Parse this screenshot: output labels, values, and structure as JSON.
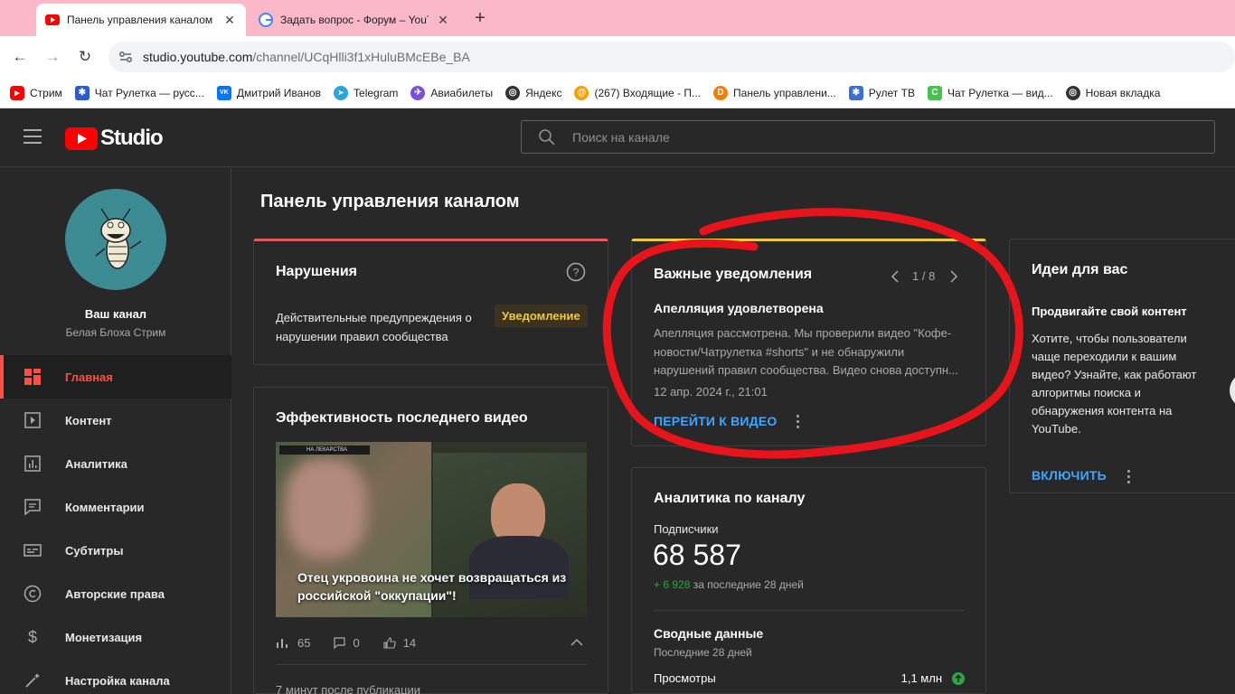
{
  "browser": {
    "tabs": [
      {
        "title": "Панель управления каналом -"
      },
      {
        "title": "Задать вопрос - Форум – YouT"
      }
    ],
    "address": {
      "domain": "studio.youtube.com",
      "path": "/channel/UCqHlli3f1xHuluBMcEBe_BA"
    },
    "bookmarks": [
      {
        "label": "Стрим",
        "icon": "youtube-icon",
        "color": "#ff0000"
      },
      {
        "label": "Чат Рулетка — русс...",
        "icon": "roulette-icon",
        "color": "#2a5bd7"
      },
      {
        "label": "Дмитрий Иванов",
        "icon": "vk-icon",
        "color": "#0077ff"
      },
      {
        "label": "Telegram",
        "icon": "telegram-icon",
        "color": "#2aa3df"
      },
      {
        "label": "Авиабилеты",
        "icon": "plane-icon",
        "color": "#7b4fd8"
      },
      {
        "label": "Яндекс",
        "icon": "globe-icon",
        "color": "#333333"
      },
      {
        "label": "(267) Входящие - П...",
        "icon": "mail-icon",
        "color": "#f2a100"
      },
      {
        "label": "Панель управлени...",
        "icon": "donation-icon",
        "color": "#f57d00"
      },
      {
        "label": "Рулет ТВ",
        "icon": "gear-icon",
        "color": "#3b6fd0"
      },
      {
        "label": "Чат Рулетка — вид...",
        "icon": "chat-icon",
        "color": "#46c34c"
      },
      {
        "label": "Новая вкладка",
        "icon": "globe-icon",
        "color": "#333333"
      }
    ]
  },
  "header": {
    "logo": "Studio",
    "search_placeholder": "Поиск на канале"
  },
  "sidebar": {
    "channel_name": "Ваш канал",
    "channel_handle": "Белая Блоха Стрим",
    "items": [
      {
        "label": "Главная",
        "icon": "dashboard-icon"
      },
      {
        "label": "Контент",
        "icon": "content-icon"
      },
      {
        "label": "Аналитика",
        "icon": "analytics-icon"
      },
      {
        "label": "Комментарии",
        "icon": "comments-icon"
      },
      {
        "label": "Субтитры",
        "icon": "subtitles-icon"
      },
      {
        "label": "Авторские права",
        "icon": "copyright-icon"
      },
      {
        "label": "Монетизация",
        "icon": "dollar-icon"
      },
      {
        "label": "Настройка канала",
        "icon": "wand-icon"
      }
    ]
  },
  "main": {
    "title": "Панель управления каналом",
    "violations": {
      "title": "Нарушения",
      "text": "Действительные предупреждения о нарушении правил сообщества",
      "badge": "Уведомление"
    },
    "performance": {
      "title": "Эффективность последнего видео",
      "video_caption": "Отец укровоина не хочет возвращаться из российской \"оккупации\"!",
      "video_overlay_tag": "НА ЛЕКАРСТВА",
      "views": "65",
      "comments": "0",
      "likes": "14",
      "footer": "7 минут после публикации"
    },
    "notifications": {
      "title": "Важные уведомления",
      "pager": "1 / 8",
      "subtitle": "Апелляция удовлетворена",
      "body": "Апелляция рассмотрена. Мы проверили видео \"Кофе-новости/Чатрулетка #shorts\" и не обнаружили нарушений правил сообщества. Видео снова доступн...",
      "date": "12 апр. 2024 г., 21:01",
      "action": "ПЕРЕЙТИ К ВИДЕО"
    },
    "analytics": {
      "title": "Аналитика по каналу",
      "subs_label": "Подписчики",
      "subs_value": "68 587",
      "subs_delta": "+ 6 928",
      "subs_period": "за последние 28 дней",
      "summary_title": "Сводные данные",
      "summary_period": "Последние 28 дней",
      "views_label": "Просмотры",
      "views_value": "1,1 млн"
    },
    "ideas": {
      "title": "Идеи для вас",
      "subtitle": "Продвигайте свой контент",
      "body": "Хотите, чтобы пользователи чаще переходили к вашим видео? Узнайте, как работают алгоритмы поиска и обнаружения контента на YouTube.",
      "action": "ВКЛЮЧИТЬ"
    }
  },
  "colors": {
    "accent": "#ff4e45",
    "link": "#3ea6ff",
    "warning": "#f0c93b",
    "positive": "#2ba640",
    "annotation": "#e8141c"
  }
}
